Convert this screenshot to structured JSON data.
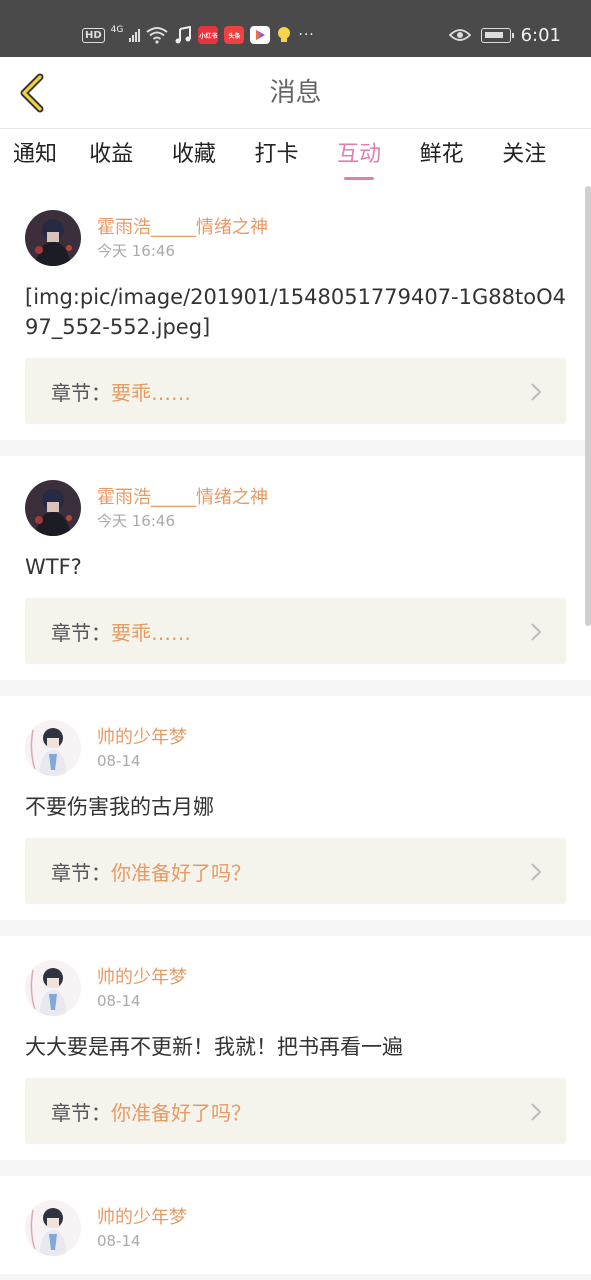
{
  "status_bar": {
    "hd": "HD",
    "network": "4G",
    "apps": [
      "小红书",
      "头条"
    ],
    "dots": "···",
    "time": "6:01"
  },
  "header": {
    "title": "消息",
    "back_icon": "chevron-left-icon"
  },
  "tabs": [
    {
      "label": "通知"
    },
    {
      "label": "收益"
    },
    {
      "label": "收藏"
    },
    {
      "label": "打卡"
    },
    {
      "label": "互动"
    },
    {
      "label": "鲜花"
    },
    {
      "label": "关注"
    }
  ],
  "active_tab": "互动",
  "colors": {
    "accent_pink": "#e27fb0",
    "name_orange": "#e89a63",
    "chapter_bg": "#f5f4ec"
  },
  "chapter_label": "章节：",
  "messages": [
    {
      "user": "霍雨浩_____情绪之神",
      "time": "今天 16:46",
      "text": "[img:pic/image/201901/1548051779407-1G88toO497_552-552.jpeg]",
      "chapter": "要乖……"
    },
    {
      "user": "霍雨浩_____情绪之神",
      "time": "今天 16:46",
      "text": "WTF?",
      "chapter": "要乖……"
    },
    {
      "user": "帅的少年梦",
      "time": "08-14",
      "text": "不要伤害我的古月娜",
      "chapter": "你准备好了吗？"
    },
    {
      "user": "帅的少年梦",
      "time": "08-14",
      "text": "大大要是再不更新！我就！把书再看一遍",
      "chapter": "你准备好了吗？"
    },
    {
      "user": "帅的少年梦",
      "time": "08-14"
    }
  ]
}
